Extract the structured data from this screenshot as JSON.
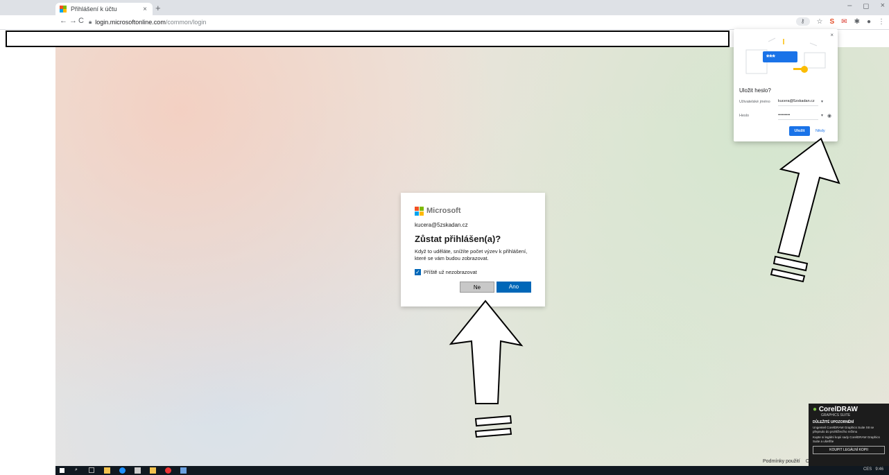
{
  "browser": {
    "tab_title": "Přihlášení k účtu",
    "tab_close": "×",
    "new_tab": "+",
    "url_host": "login.microsoftonline.com",
    "url_path": "/common/login",
    "back": "←",
    "forward": "→",
    "reload": "C"
  },
  "ms_dialog": {
    "brand": "Microsoft",
    "identity": "kucera@5zskadan.cz",
    "title": "Zůstat přihlášen(a)?",
    "description": "Když to uděláte, snížíte počet výzev k přihlášení, které se vám budou zobrazovat.",
    "checkbox_label": "Příště už nezobrazovat",
    "checkbox_checked": true,
    "no_label": "Ne",
    "yes_label": "Ano",
    "accent": "#0067b8"
  },
  "save_password": {
    "title": "Uložit heslo?",
    "username_label": "Uživatelské jméno",
    "username_value": "kucera@5zskadan.cz",
    "password_label": "Heslo",
    "password_value": "•••••••••",
    "save_label": "Uložit",
    "never_label": "Nikdy",
    "illustration_text": "***",
    "accent": "#1a73e8"
  },
  "footer": {
    "terms": "Podmínky použití",
    "privacy": "Och"
  },
  "corel_notice": {
    "brand": "CorelDRAW",
    "suite": "GRAPHICS SUITE",
    "warning": "DŮLEŽITÉ UPOZORNĚNÍ",
    "text1": "Ungenteil CorelDRAW Graphics Suite X8 se přepnulo do prohlížecího režimu",
    "text2": "Kupte si legální kopii sady CorelDRAW Graphics Suite a ušetříte",
    "buy_label": "KOUPIT LEGÁLNÍ KOPII"
  },
  "taskbar": {
    "language": "CES",
    "time": "9:46"
  }
}
